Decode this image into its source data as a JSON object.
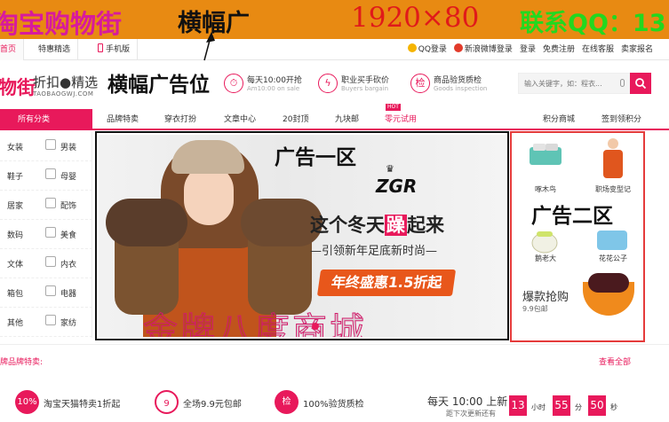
{
  "banner": {
    "site_name": "淘宝购物街",
    "label": "横幅广",
    "size": "1920×80",
    "contact": "联系QQ：13"
  },
  "topnav": {
    "tabs": [
      {
        "label": "首页",
        "active": true
      },
      {
        "label": "特惠精选",
        "active": false
      },
      {
        "label": "手机版",
        "active": false
      }
    ],
    "right": [
      "QQ登录",
      "新浪微博登录",
      "登录",
      "免费注册",
      "在线客服",
      "卖家报名"
    ]
  },
  "header": {
    "logo": "物街",
    "slogan": "折扣●精选",
    "domain": "TAOBAOGWJ.COM",
    "ad_label": "横幅广告位",
    "features": [
      {
        "icon": "⏱",
        "title": "每天10:00开抢",
        "sub": "Am10:00 on sale"
      },
      {
        "icon": "ϟ",
        "title": "职业买手砍价",
        "sub": "Buyers bargain"
      },
      {
        "icon": "检",
        "title": "商品验货质检",
        "sub": "Goods inspection"
      }
    ],
    "search_placeholder": "输入关键字，如：程衣..."
  },
  "catnav": {
    "all": "所有分类",
    "items": [
      "品牌特卖",
      "穿衣打扮",
      "文章中心",
      "20封顶",
      "九块邮",
      "零元试用",
      "积分商城",
      "签到领积分"
    ],
    "hot": "HOT"
  },
  "sidebar": {
    "rows": [
      [
        "女装",
        "男装"
      ],
      [
        "鞋子",
        "母婴"
      ],
      [
        "居家",
        "配饰"
      ],
      [
        "数码",
        "美食"
      ],
      [
        "文体",
        "内衣"
      ],
      [
        "箱包",
        "电器"
      ],
      [
        "其他",
        "家纺"
      ]
    ]
  },
  "slider": {
    "ad_label": "广告一区",
    "brand": "ZGR",
    "headline_pre": "这个冬天",
    "headline_hl": "躁",
    "headline_post": "起来",
    "subline": "—引领新年足底新时尚—",
    "promo": "年终盛惠1.5折起",
    "watermark": "金牌八度商城"
  },
  "adpanel": {
    "ad_label": "广告二区",
    "products": [
      "啄木鸟",
      "职场变型记",
      "鹅老大",
      "花花公子"
    ],
    "hotbuy_title": "爆款抢购",
    "hotbuy_sub": "9.9包邮"
  },
  "brandrow": {
    "left": "牌品牌特卖:",
    "right": "查看全部"
  },
  "bottom": {
    "items": [
      {
        "icon": "10%",
        "text": "淘宝天猫特卖1折起"
      },
      {
        "icon": "9",
        "text": "全场9.9元包邮"
      },
      {
        "icon": "检",
        "text": "100%验货质检"
      }
    ],
    "countdown_title": "每天 10:00 上新",
    "countdown_sub": "距下次更新还有",
    "hours": "13",
    "minutes": "55",
    "seconds": "50",
    "hour_unit": "小时",
    "minute_unit": "分",
    "second_unit": "秒"
  },
  "colors": {
    "accent": "#e8195b",
    "banner_bg": "#e88a12",
    "ad_border": "#e53b3b"
  }
}
